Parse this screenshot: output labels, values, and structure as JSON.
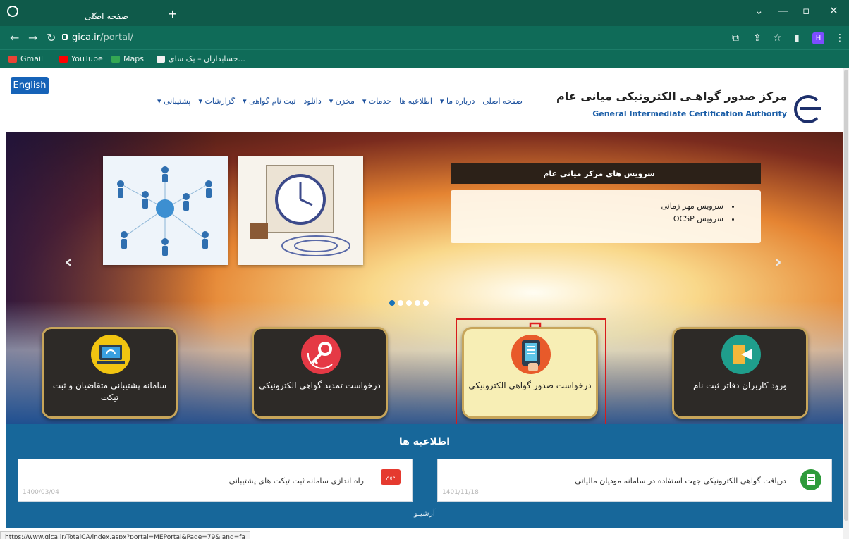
{
  "browser": {
    "tab_title": "صفحه اصلی",
    "tab_close": "✕",
    "new_tab": "+",
    "url_host": "gica.ir",
    "url_path": "/portal/",
    "bookmarks": [
      "Gmail",
      "YouTube",
      "Maps",
      "حسابداران – یک سای..."
    ],
    "profile_initial": "H"
  },
  "header": {
    "english_button": "English",
    "logo_fa": "مرکز صدور گواهـی الکترونیکی میانی عام",
    "logo_en": "General Intermediate Certification Authority",
    "nav": [
      "صفحه اصلی",
      "درباره ما ▾",
      "اطلاعیه ها",
      "خدمات ▾",
      "مخزن ▾",
      "دانلود",
      "ثبت نام گواهی ▾",
      "گزارشات ▾",
      "پشتیبانی ▾"
    ]
  },
  "hero": {
    "services_title": "سرویس های مرکز میانی عام",
    "services": [
      "سرویس مهر زمانی",
      "سرویس OCSP"
    ],
    "prev": "‹",
    "next": "›"
  },
  "tiles": [
    {
      "label": "ورود کاربران دفاتر ثبت نام",
      "color": "#1f9e8c",
      "icon": "door-enter-icon"
    },
    {
      "label": "درخواست صدور گواهی الکترونیکی",
      "color": "#e85a2a",
      "icon": "tablet-touch-icon"
    },
    {
      "label": "درخواست تمدید گواهی الکترونیکی",
      "color": "#e53945",
      "icon": "key-renew-icon"
    },
    {
      "label": "سامانه پشتیبانی متقاضیان و ثبت تیکت",
      "color": "#f2c511",
      "icon": "headset-support-icon"
    }
  ],
  "news": {
    "title": "اطلاعیه ها",
    "items": [
      {
        "text": "دریافت گواهی الکترونیکی جهت استفاده در سامانه مودیان مالیاتی",
        "date": "1401/11/18"
      },
      {
        "text": "راه اندازی سامانه ثبت تیکت های پشتیبانی",
        "date": "1400/03/04",
        "badge": "مهم"
      }
    ],
    "archive": "آرشیـو"
  },
  "status_url": "https://www.gica.ir/TotalCA/index.aspx?portal=MEPortal&Page=79&lang=fa"
}
